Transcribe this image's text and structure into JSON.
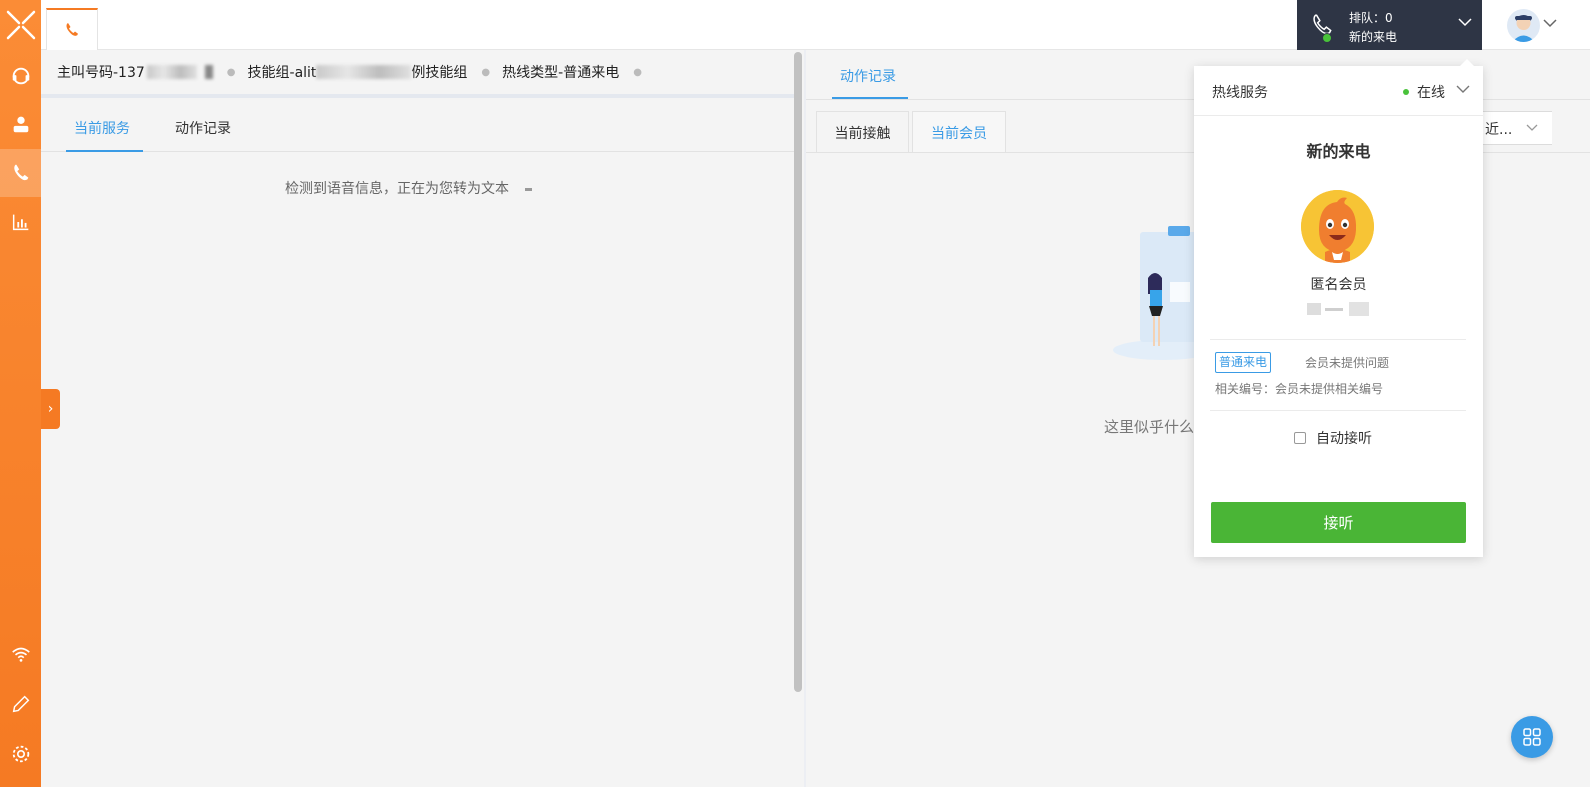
{
  "sidebar": {
    "items": [
      {
        "name": "headset-icon"
      },
      {
        "name": "user-list-icon"
      },
      {
        "name": "phone-icon",
        "active": true
      },
      {
        "name": "chart-icon"
      }
    ],
    "bottom": [
      {
        "name": "wifi-icon"
      },
      {
        "name": "pencil-icon"
      },
      {
        "name": "gear-icon"
      }
    ],
    "accent": "#f57a23"
  },
  "topbar": {
    "queue_label": "排队：0",
    "incoming_label": "新的来电"
  },
  "info_bar": {
    "caller_prefix": "主叫号码-137",
    "skill_prefix": "技能组-alit",
    "skill_suffix": "例技能组",
    "hotline_type": "热线类型-普通来电"
  },
  "left_tabs": {
    "current_service": "当前服务",
    "action_log": "动作记录"
  },
  "voice_message": "检测到语音信息，正在为您转为文本",
  "right_tabs": {
    "action_log": "动作记录",
    "current_contact": "当前接触",
    "current_member": "当前会员",
    "select_value": "近..."
  },
  "empty_text": "这里似乎什么",
  "popup": {
    "service_label": "热线服务",
    "status_label": "在线",
    "title": "新的来电",
    "member_name": "匿名会员",
    "call_type_badge": "普通来电",
    "issue_text": "会员未提供问题",
    "related_text": "相关编号：会员未提供相关编号",
    "auto_answer_label": "自动接听",
    "answer_button": "接听"
  }
}
